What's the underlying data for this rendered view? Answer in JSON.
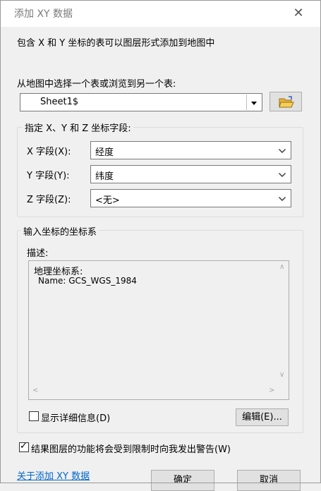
{
  "window": {
    "title": "添加 XY 数据",
    "close_symbol": "✕"
  },
  "description": "包含 X 和 Y 坐标的表可以图层形式添加到地图中",
  "table_select": {
    "label": "从地图中选择一个表或浏览到另一个表:",
    "value": "Sheet1$"
  },
  "fields": {
    "group_label": "指定 X、Y 和 Z 坐标字段:",
    "x": {
      "label": "X 字段(X):",
      "value": "经度"
    },
    "y": {
      "label": "Y 字段(Y):",
      "value": "纬度"
    },
    "z": {
      "label": "Z 字段(Z):",
      "value": "<无>"
    }
  },
  "coord_system": {
    "group_label": "输入坐标的坐标系",
    "desc_label": "描述:",
    "desc_line1": "地理坐标系:",
    "desc_line2": "Name: GCS_WGS_1984",
    "show_details_label": "显示详细信息(D)",
    "edit_button": "编辑(E)..."
  },
  "warn_checkbox": {
    "label": "结果图层的功能将会受到限制时向我发出警告(W)",
    "checked": true,
    "check_symbol": "✓"
  },
  "footer": {
    "help_link": "关于添加 XY 数据",
    "ok_button": "确定",
    "cancel_button": "取消"
  },
  "colors": {
    "folder_icon": "#e8b33a",
    "link": "#0066cc"
  }
}
